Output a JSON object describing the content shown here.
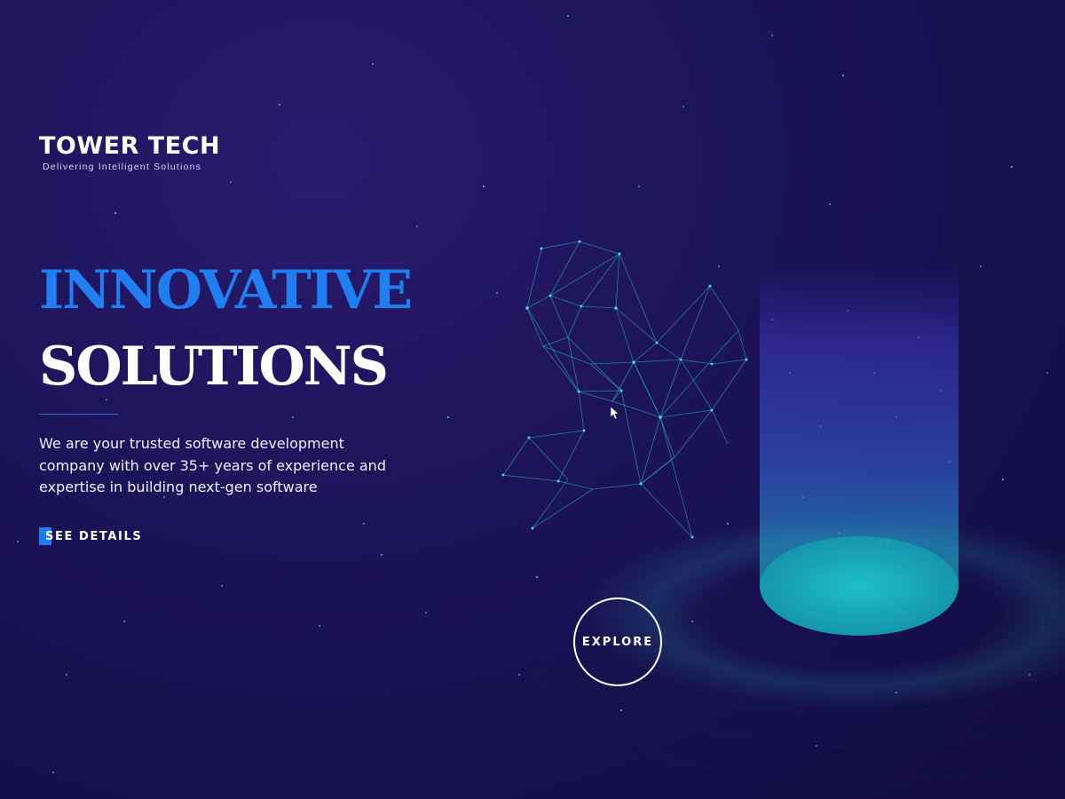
{
  "brand": {
    "name": "TOWER TECH",
    "tagline": "Delivering Intelligent Solutions"
  },
  "hero": {
    "headline_line1": "INNOVATIVE",
    "headline_line2": "SOLUTIONS",
    "description": "We are your trusted software development company with over 35+ years of experience and expertise in building next-gen software",
    "cta_label": "SEE DETAILS",
    "explore_label": "EXPLORE"
  },
  "colors": {
    "accent": "#1f7ff0",
    "background": "#1c1459",
    "network": "#2cc4c8",
    "cylinder_top": "#5b5cf0",
    "cylinder_bottom": "#18b8c0"
  },
  "icons": {
    "cursor": "mouse-pointer-icon"
  }
}
